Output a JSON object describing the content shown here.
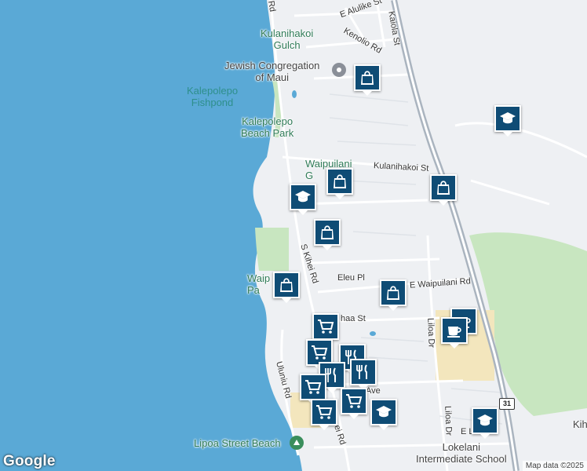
{
  "colors": {
    "ocean": "#5aa9d6",
    "land": "#eef0f3",
    "park": "#c8e6c0",
    "highway": "#aab4bf",
    "marker": "#0f4c75",
    "commercial": "#f3e6bd"
  },
  "places": {
    "kulanihakoi_gulch": "Kulanihakoi\nGulch",
    "jewish_congregation": "Jewish Congregation\nof Maui",
    "kalepolepo_fishpond": "Kalepolepo\nFishpond",
    "kalepolepo_beach_park": "Kalepolepo\nBeach Park",
    "waipuilani_g": "Waipuilani\nG",
    "waip_pa": "Waip\nPa",
    "lipoa_street_beach": "Lipoa Street Beach",
    "lokelani_school": "Lokelani\nIntermediate School",
    "kih": "Kih"
  },
  "roads": {
    "e_alulike": "E Alulike St",
    "kenolio": "Kenolio Rd",
    "kaiola": "Kaiola St",
    "kulanihakoi_st": "Kulanihakoi St",
    "s_kihei_rd": "S Kihei Rd",
    "eleu_pl": "Eleu Pl",
    "e_waipuilani": "E Waipuilani Rd",
    "haa_st": "haa St",
    "liloa_dr_1": "Liloa Dr",
    "liloa_dr_2": "Liloa Dr",
    "uluniu": "Uluniu Rd",
    "ei_rd": "ei Rd",
    "ave": "Ave",
    "e_l": "E L",
    "rd_top": "Rd",
    "route_31": "31"
  },
  "markers": [
    {
      "icon": "bag-icon"
    },
    {
      "icon": "graduation-cap-icon"
    },
    {
      "icon": "bag-icon"
    },
    {
      "icon": "bag-icon"
    },
    {
      "icon": "graduation-cap-icon"
    },
    {
      "icon": "bag-icon"
    },
    {
      "icon": "bag-icon"
    },
    {
      "icon": "bag-icon"
    },
    {
      "icon": "cart-icon"
    },
    {
      "icon": "coffee-icon"
    },
    {
      "icon": "cart-icon"
    },
    {
      "icon": "utensils-icon"
    },
    {
      "icon": "utensils-icon"
    },
    {
      "icon": "utensils-icon"
    },
    {
      "icon": "coffee-icon"
    },
    {
      "icon": "cart-icon"
    },
    {
      "icon": "cart-icon"
    },
    {
      "icon": "cart-icon"
    },
    {
      "icon": "graduation-cap-icon"
    },
    {
      "icon": "graduation-cap-icon"
    }
  ],
  "branding": {
    "logo": "Google",
    "attribution": "Map data ©2025"
  }
}
